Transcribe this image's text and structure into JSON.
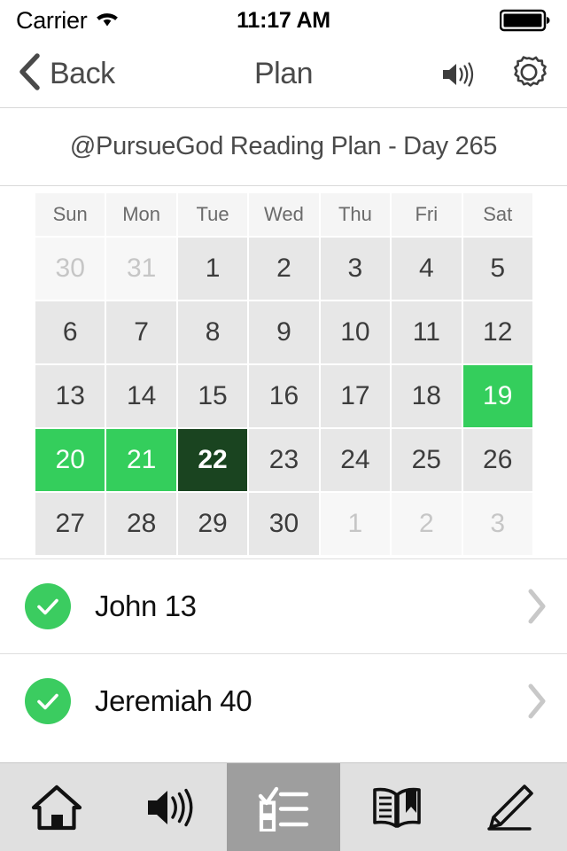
{
  "status_bar": {
    "carrier": "Carrier",
    "wifi_icon": "wifi-icon",
    "time": "11:17 AM",
    "battery_icon": "battery-full-icon"
  },
  "nav_bar": {
    "back_label": "Back",
    "back_icon": "chevron-left-icon",
    "title": "Plan",
    "audio_icon": "speaker-icon",
    "settings_icon": "gear-icon"
  },
  "plan_header": {
    "title": "@PursueGod Reading Plan - Day 265"
  },
  "calendar": {
    "weekday_headers": [
      "Sun",
      "Mon",
      "Tue",
      "Wed",
      "Thu",
      "Fri",
      "Sat"
    ],
    "weeks": [
      [
        {
          "day": "30",
          "state": "other"
        },
        {
          "day": "31",
          "state": "other"
        },
        {
          "day": "1",
          "state": "normal"
        },
        {
          "day": "2",
          "state": "normal"
        },
        {
          "day": "3",
          "state": "normal"
        },
        {
          "day": "4",
          "state": "normal"
        },
        {
          "day": "5",
          "state": "normal"
        }
      ],
      [
        {
          "day": "6",
          "state": "normal"
        },
        {
          "day": "7",
          "state": "normal"
        },
        {
          "day": "8",
          "state": "normal"
        },
        {
          "day": "9",
          "state": "normal"
        },
        {
          "day": "10",
          "state": "normal"
        },
        {
          "day": "11",
          "state": "normal"
        },
        {
          "day": "12",
          "state": "normal"
        }
      ],
      [
        {
          "day": "13",
          "state": "normal"
        },
        {
          "day": "14",
          "state": "normal"
        },
        {
          "day": "15",
          "state": "normal"
        },
        {
          "day": "16",
          "state": "normal"
        },
        {
          "day": "17",
          "state": "normal"
        },
        {
          "day": "18",
          "state": "normal"
        },
        {
          "day": "19",
          "state": "done"
        }
      ],
      [
        {
          "day": "20",
          "state": "done"
        },
        {
          "day": "21",
          "state": "done"
        },
        {
          "day": "22",
          "state": "today"
        },
        {
          "day": "23",
          "state": "normal"
        },
        {
          "day": "24",
          "state": "normal"
        },
        {
          "day": "25",
          "state": "normal"
        },
        {
          "day": "26",
          "state": "normal"
        }
      ],
      [
        {
          "day": "27",
          "state": "normal"
        },
        {
          "day": "28",
          "state": "normal"
        },
        {
          "day": "29",
          "state": "normal"
        },
        {
          "day": "30",
          "state": "normal"
        },
        {
          "day": "1",
          "state": "other"
        },
        {
          "day": "2",
          "state": "other"
        },
        {
          "day": "3",
          "state": "other"
        }
      ]
    ]
  },
  "reading_list": {
    "items": [
      {
        "label": "John 13",
        "completed": true,
        "check_icon": "check-circle-icon",
        "chevron_icon": "chevron-right-icon"
      },
      {
        "label": "Jeremiah 40",
        "completed": true,
        "check_icon": "check-circle-icon",
        "chevron_icon": "chevron-right-icon"
      }
    ]
  },
  "tab_bar": {
    "tabs": [
      {
        "name": "home",
        "icon": "home-icon",
        "active": false
      },
      {
        "name": "audio",
        "icon": "speaker-icon",
        "active": false
      },
      {
        "name": "plan",
        "icon": "checklist-icon",
        "active": true
      },
      {
        "name": "bible",
        "icon": "book-bookmark-icon",
        "active": false
      },
      {
        "name": "notes",
        "icon": "pencil-icon",
        "active": false
      }
    ]
  },
  "colors": {
    "completed_green": "#34ce5c",
    "today_dark_green": "#1a4420",
    "check_green": "#3bcc60",
    "cell_gray": "#e7e7e7",
    "other_month_gray": "#f7f7f7",
    "tab_bar_gray": "#e0e0e0",
    "tab_active_gray": "#9e9e9e",
    "text_dark": "#4a4a4a",
    "chevron_gray": "#c8c8c8"
  }
}
